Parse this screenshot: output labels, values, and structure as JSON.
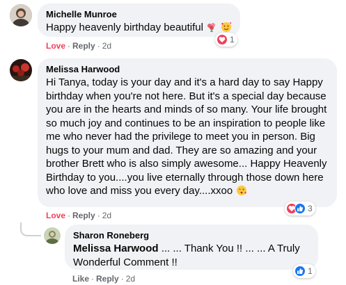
{
  "comments": [
    {
      "author": "Michelle Munroe",
      "text": "Happy heavenly birthday beautiful",
      "emojis": [
        "flower-bouquet-emoji",
        "smiling-face-with-hearts-emoji"
      ],
      "actions": {
        "love": "Love",
        "reply": "Reply",
        "time": "2d"
      },
      "reaction_count": "1",
      "reaction_icons": [
        "love"
      ],
      "avatar_color": "#7a6a5f"
    },
    {
      "author": "Melissa Harwood",
      "text": "Hi Tanya, today is your day and it's a hard day to say Happy birthday when you're not here. But it's a special day because you are in the hearts and minds of so many. Your life brought so much joy and continues to be an inspiration to people like me who never had the privilege to meet you in person. Big hugs to your mum and dad. They are so amazing and your brother Brett who is also simply awesome... Happy Heavenly Birthday to you....you live eternally through those down here who love and miss you every day....xxoo",
      "emojis": [
        "face-blowing-kiss-emoji"
      ],
      "actions": {
        "love": "Love",
        "reply": "Reply",
        "time": "2d"
      },
      "reaction_count": "3",
      "reaction_icons": [
        "love",
        "like"
      ],
      "avatar_color": "#5a2d2a"
    },
    {
      "author": "Sharon Roneberg",
      "mention": "Melissa Harwood",
      "text": " ... ... Thank You !! ... ... A Truly Wonderful Comment !!",
      "actions": {
        "like": "Like",
        "reply": "Reply",
        "time": "2d"
      },
      "reaction_count": "1",
      "reaction_icons": [
        "like"
      ],
      "avatar_color": "#8ea07a"
    }
  ],
  "colors": {
    "bubble": "#f0f2f5",
    "love": "#f33e58",
    "like": "#1877f2",
    "meta": "#65676b"
  }
}
